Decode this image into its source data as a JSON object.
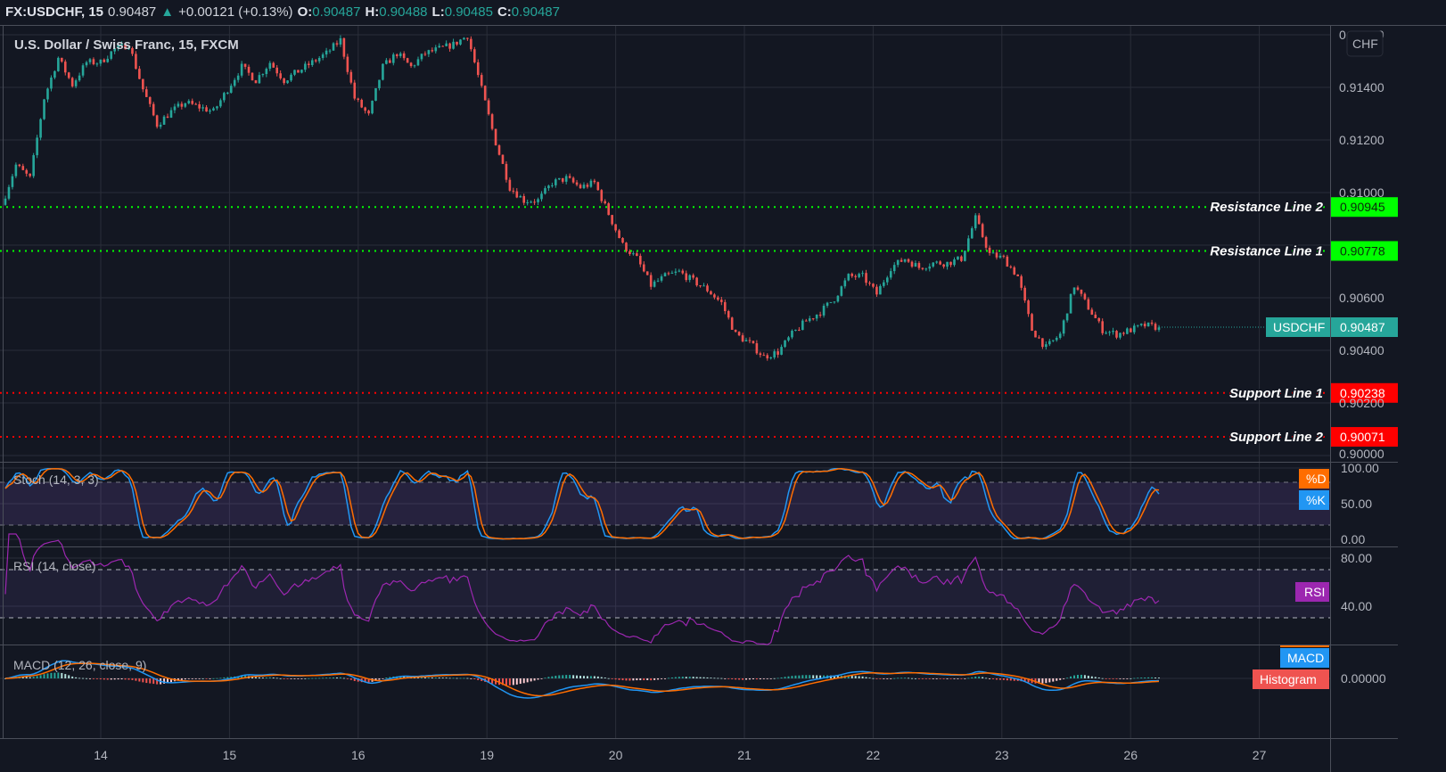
{
  "header": {
    "symbol": "FX:USDCHF, 15",
    "last": "0.90487",
    "direction_icon": "triangle-up",
    "change": "+0.00121 (+0.13%)",
    "open_label": "O:",
    "open": "0.90487",
    "high_label": "H:",
    "high": "0.90488",
    "low_label": "L:",
    "low": "0.90485",
    "close_label": "C:",
    "close": "0.90487"
  },
  "colors": {
    "background": "#131722",
    "grid": "#2a2e39",
    "up": "#26a69a",
    "down": "#ef5350",
    "resistance": "#00ff00",
    "support": "#ff0000",
    "stoch_k": "#2196f3",
    "stoch_d": "#ff6d00",
    "rsi": "#9c27b0",
    "macd": "#2196f3",
    "signal": "#ff6d00",
    "band": "#7e57c2"
  },
  "chart_data": [
    {
      "type": "candlestick",
      "title": "U.S. Dollar / Swiss Franc, 15, FXCM",
      "currency_badge": "CHF",
      "x_tick_labels": [
        "14",
        "15",
        "16",
        "19",
        "20",
        "21",
        "22",
        "23",
        "26",
        "27"
      ],
      "y_tick_labels": [
        "0.91600",
        "0.91400",
        "0.91200",
        "0.91000",
        "0.90600",
        "0.90400",
        "0.90200",
        "0.90000"
      ],
      "ylim": [
        0.9,
        0.9165
      ],
      "grid": true,
      "close_path": [
        0.90953,
        0.91105,
        0.91054,
        0.91359,
        0.91512,
        0.9141,
        0.91495,
        0.91495,
        0.91546,
        0.91563,
        0.91393,
        0.91258,
        0.91308,
        0.91342,
        0.91325,
        0.91308,
        0.91393,
        0.91478,
        0.91427,
        0.91495,
        0.91427,
        0.91461,
        0.91495,
        0.91529,
        0.9158,
        0.91359,
        0.91292,
        0.91478,
        0.91529,
        0.91478,
        0.91529,
        0.91546,
        0.91563,
        0.91597,
        0.91393,
        0.9119,
        0.9102,
        0.9097,
        0.9097,
        0.91037,
        0.91054,
        0.9102,
        0.91037,
        0.90919,
        0.908,
        0.90749,
        0.90647,
        0.90681,
        0.90698,
        0.90664,
        0.9063,
        0.9058,
        0.90461,
        0.90427,
        0.90376,
        0.90393,
        0.90461,
        0.90512,
        0.90546,
        0.90597,
        0.90681,
        0.90681,
        0.90614,
        0.90715,
        0.90749,
        0.90715,
        0.90732,
        0.90732,
        0.90749,
        0.90902,
        0.90766,
        0.90749,
        0.90681,
        0.90478,
        0.9041,
        0.90461,
        0.90647,
        0.90563,
        0.90478,
        0.90461,
        0.90478,
        0.90495,
        0.90487
      ],
      "current_price": {
        "label": "USDCHF",
        "value": "0.90487"
      },
      "horizontal_lines": [
        {
          "name": "Resistance Line 2",
          "value": "0.90945",
          "kind": "resistance"
        },
        {
          "name": "Resistance Line 1",
          "value": "0.90778",
          "kind": "resistance"
        },
        {
          "name": "Support Line 1",
          "value": "0.90238",
          "kind": "support"
        },
        {
          "name": "Support Line 2",
          "value": "0.90071",
          "kind": "support"
        }
      ]
    },
    {
      "type": "line",
      "title": "Stoch (14, 3, 3)",
      "params": [
        14,
        3,
        3
      ],
      "y_tick_labels": [
        "100.00",
        "50.00",
        "0.00"
      ],
      "ylim": [
        0,
        100
      ],
      "bands": [
        20,
        80
      ],
      "series": [
        {
          "name": "%D"
        },
        {
          "name": "%K"
        }
      ]
    },
    {
      "type": "line",
      "title": "RSI (14, close)",
      "params": [
        14
      ],
      "y_tick_labels": [
        "80.00",
        "40.00"
      ],
      "bands": [
        30,
        70
      ],
      "series": [
        {
          "name": "RSI"
        }
      ]
    },
    {
      "type": "line",
      "title": "MACD (12, 26, close, 9)",
      "params": [
        12,
        26,
        9
      ],
      "y_tick_labels": [
        "0.00000"
      ],
      "series": [
        {
          "name": "MACD"
        },
        {
          "name": "Histogram"
        }
      ]
    }
  ]
}
